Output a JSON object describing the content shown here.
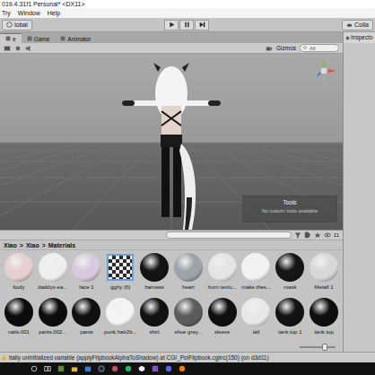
{
  "window": {
    "title": "019.4.31f1 Personal* <DX11>"
  },
  "menu": [
    "Try",
    "Window",
    "Help"
  ],
  "toolbar": {
    "left": "lobal",
    "right": "Colla"
  },
  "scene_tabs": [
    {
      "label": "e",
      "selected": true
    },
    {
      "label": "Game",
      "selected": false
    },
    {
      "label": "Animator",
      "selected": false
    }
  ],
  "scene_toolbar": {
    "gizmos": "Gizmos",
    "search": "All"
  },
  "tools_overlay": {
    "title": "Tools",
    "message": "No custom tools available"
  },
  "inspector": {
    "tab": "Inspecto"
  },
  "project": {
    "breadcrumb": [
      "Xiao",
      "Xiao",
      "Materials"
    ],
    "separator": ">",
    "hidden_count": "11",
    "zoom": {
      "level": 0.7
    },
    "materials": [
      {
        "name": "body",
        "kind": "sphere",
        "color": "#e6cfd0"
      },
      {
        "name": "daddys ea...",
        "kind": "sphere",
        "color": "#eeeeee"
      },
      {
        "name": "face 1",
        "kind": "sphere",
        "color": "#d9c9dc"
      },
      {
        "name": "gghy (6)",
        "kind": "checker",
        "color": "#2a2a2a"
      },
      {
        "name": "harness",
        "kind": "sphere",
        "color": "#141414"
      },
      {
        "name": "heart",
        "kind": "sphere",
        "color": "#9ea3aa"
      },
      {
        "name": "horn textu...",
        "kind": "sphere",
        "color": "#e4e4e4"
      },
      {
        "name": "make thes...",
        "kind": "sphere",
        "color": "#f2f2f2"
      },
      {
        "name": "mask",
        "kind": "sphere",
        "color": "#161616"
      },
      {
        "name": "Metall 1",
        "kind": "sphere",
        "color": "#d8d8d8"
      },
      {
        "name": "nails.001",
        "kind": "sphere",
        "color": "#0c0c0c"
      },
      {
        "name": "pants.002...",
        "kind": "sphere",
        "color": "#0c0c0c"
      },
      {
        "name": "pants",
        "kind": "sphere",
        "color": "#101010"
      },
      {
        "name": "punk hair2b...",
        "kind": "sphere",
        "color": "#f4f4f4"
      },
      {
        "name": "shirt",
        "kind": "sphere",
        "color": "#121212"
      },
      {
        "name": "shoe grey...",
        "kind": "sphere",
        "color": "#5c5c5c"
      },
      {
        "name": "sleeve",
        "kind": "sphere",
        "color": "#0f0f0f"
      },
      {
        "name": "tail",
        "kind": "sphere",
        "color": "#e8e8e8"
      },
      {
        "name": "tank top 1",
        "kind": "sphere",
        "color": "#131313"
      },
      {
        "name": "tank top",
        "kind": "sphere",
        "color": "#0e0e0e"
      }
    ]
  },
  "status_bar": {
    "message": "tially uninitialized variable (applyFlipbookAlphaToShadow) at CGI_PoiFlipbook.cginc(150) (on d3d11)"
  }
}
